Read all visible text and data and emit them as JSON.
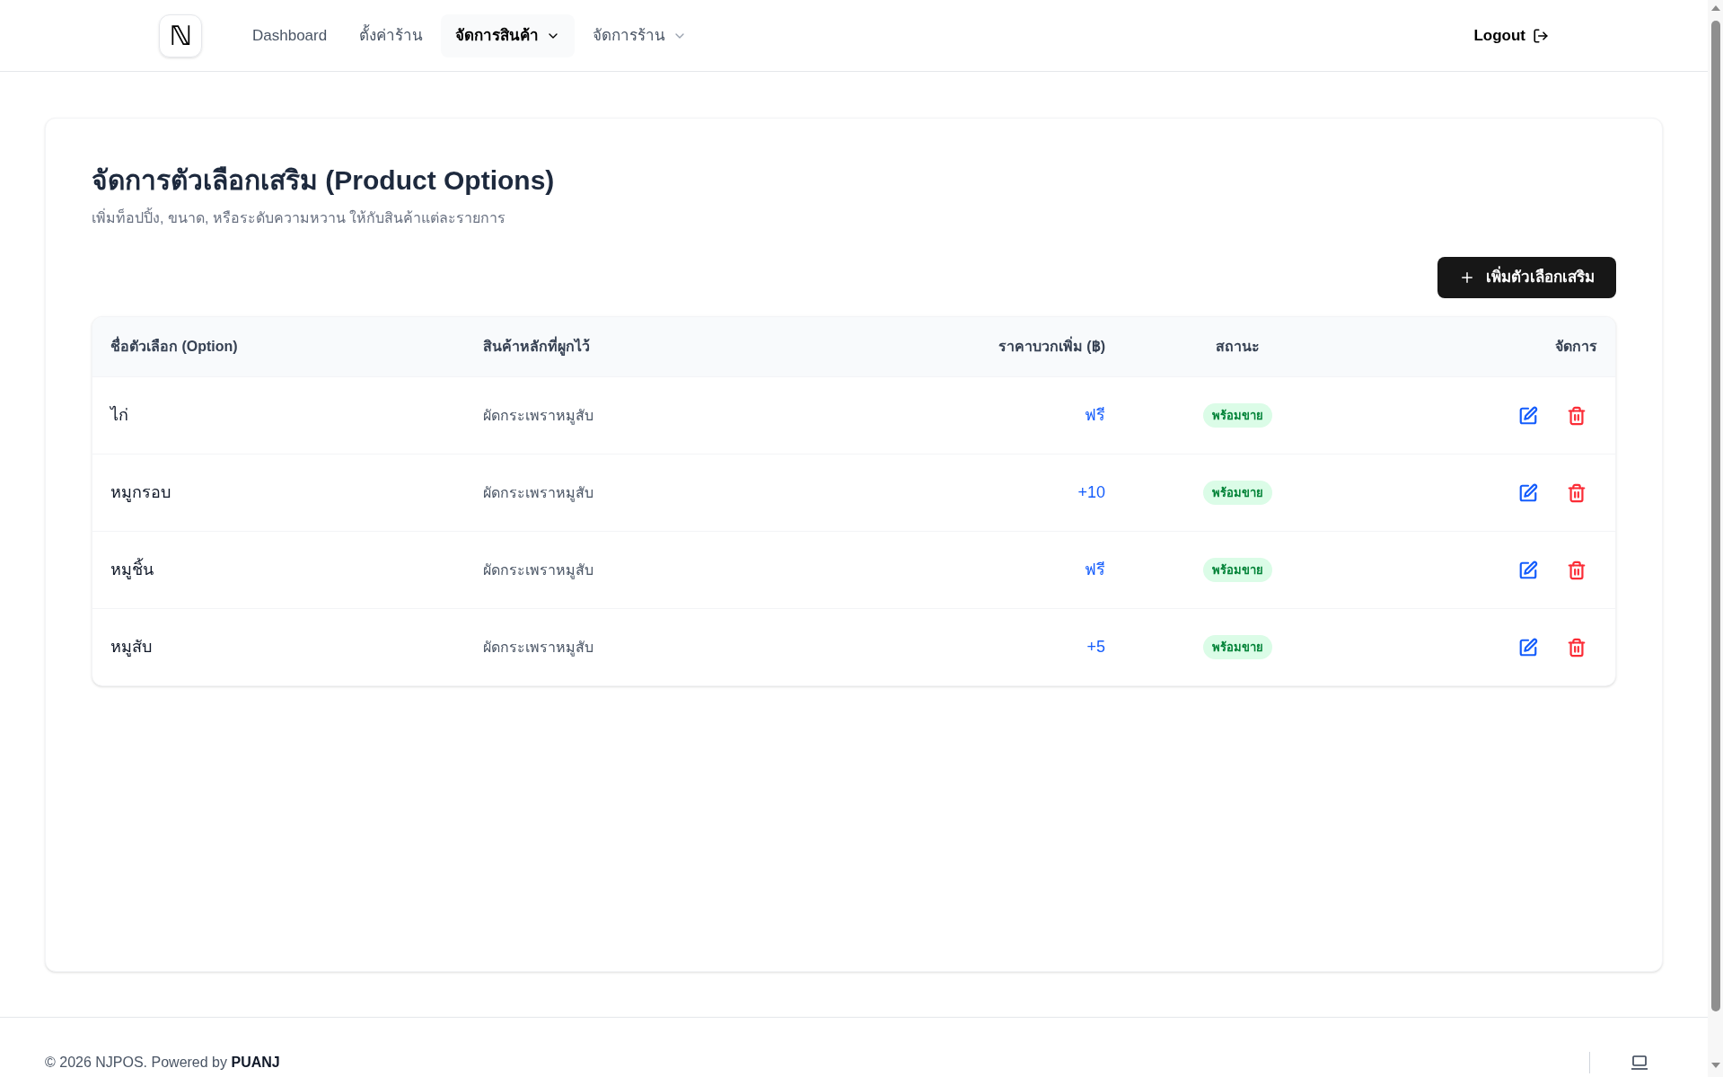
{
  "header": {
    "logo": "ℕ",
    "nav": [
      {
        "label": "Dashboard",
        "selected": false,
        "dropdown": false
      },
      {
        "label": "ตั้งค่าร้าน",
        "selected": false,
        "dropdown": false
      },
      {
        "label": "จัดการสินค้า",
        "selected": true,
        "dropdown": true
      },
      {
        "label": "จัดการร้าน",
        "selected": false,
        "dropdown": true
      }
    ],
    "logout": "Logout"
  },
  "page": {
    "title": "จัดการตัวเลือกเสริม (Product Options)",
    "subtitle": "เพิ่มท็อปปิ้ง, ขนาด, หรือระดับความหวาน ให้กับสินค้าแต่ละรายการ",
    "add_button": "เพิ่มตัวเลือกเสริม"
  },
  "table": {
    "columns": [
      "ชื่อตัวเลือก (Option)",
      "สินค้าหลักที่ผูกไว้",
      "ราคาบวกเพิ่ม (฿)",
      "สถานะ",
      "จัดการ"
    ],
    "rows": [
      {
        "name": "ไก่",
        "product": "ผัดกระเพราหมูสับ",
        "price": "ฟรี",
        "status": "พร้อมขาย"
      },
      {
        "name": "หมูกรอบ",
        "product": "ผัดกระเพราหมูสับ",
        "price": "+10",
        "status": "พร้อมขาย"
      },
      {
        "name": "หมูชิ้น",
        "product": "ผัดกระเพราหมูสับ",
        "price": "ฟรี",
        "status": "พร้อมขาย"
      },
      {
        "name": "หมูสับ",
        "product": "ผัดกระเพราหมูสับ",
        "price": "+5",
        "status": "พร้อมขาย"
      }
    ]
  },
  "footer": {
    "text": "© 2026 NJPOS. Powered by **PUANJ**"
  }
}
